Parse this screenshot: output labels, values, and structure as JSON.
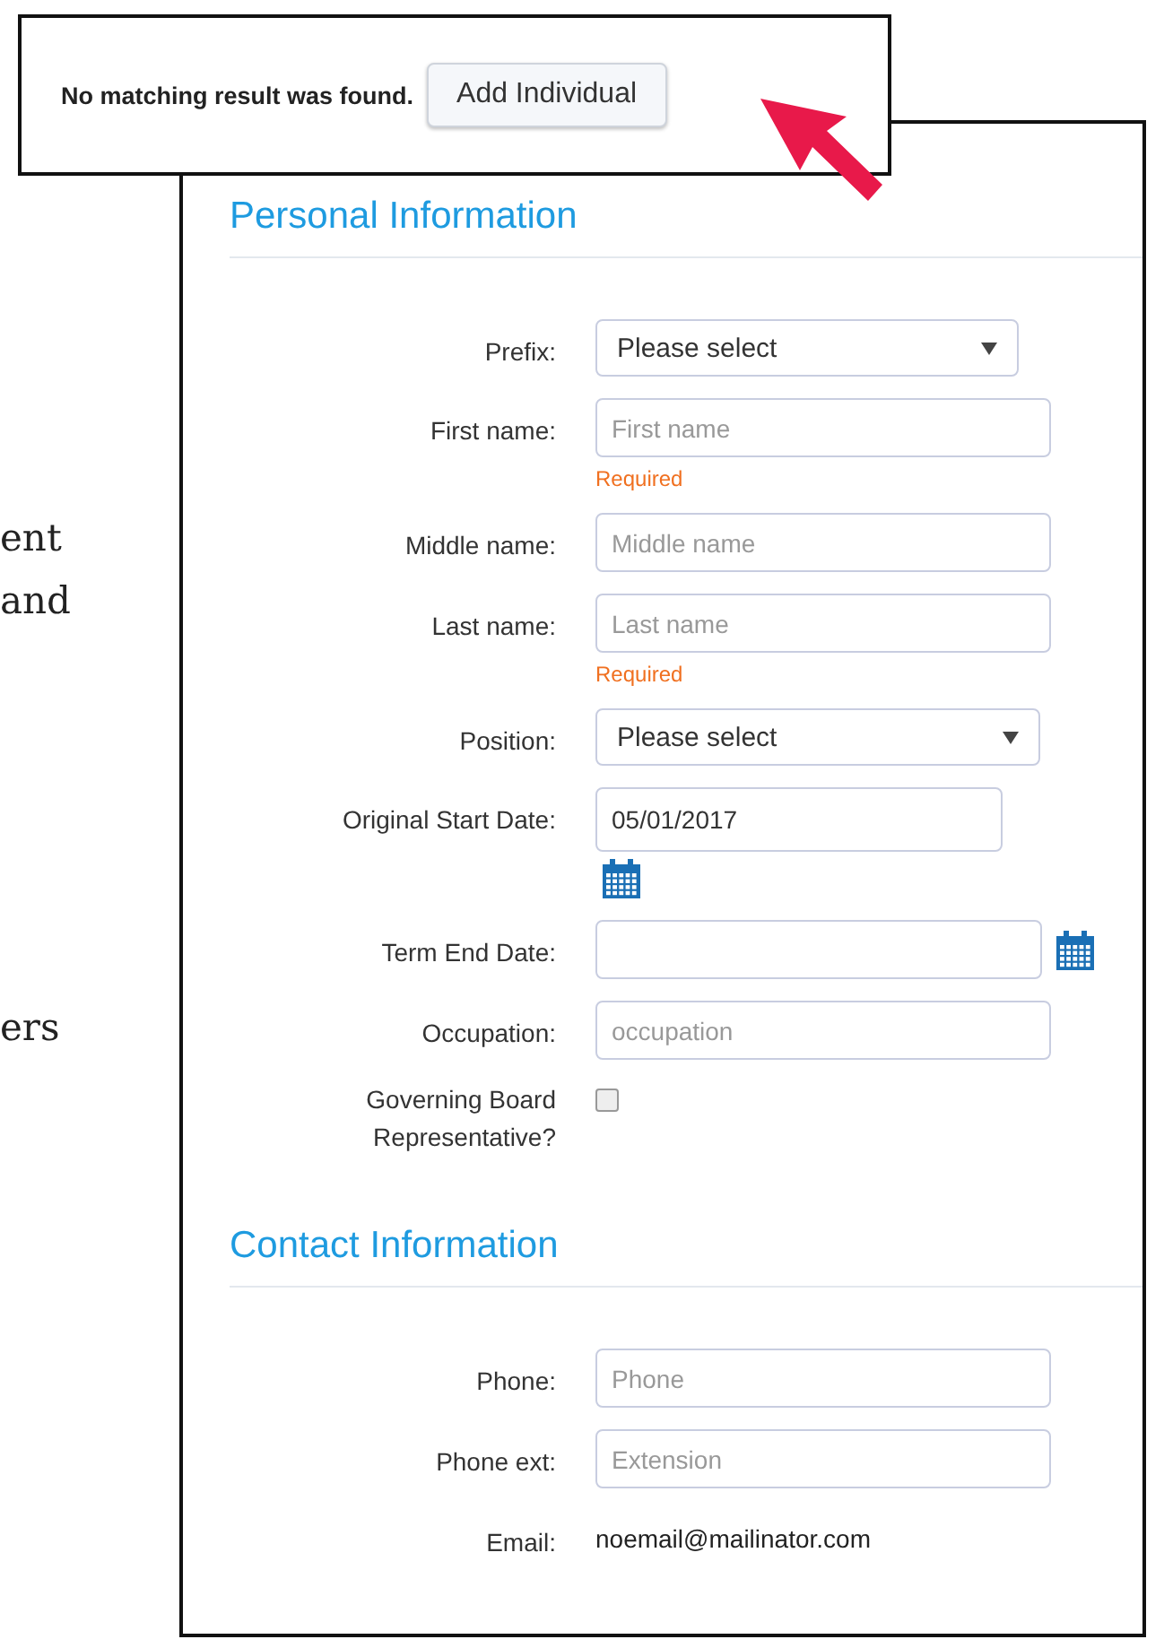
{
  "callout": {
    "message": "No matching result was found.",
    "button": "Add Individual"
  },
  "background_text": [
    "ent",
    "and",
    "ers"
  ],
  "sections": [
    {
      "title": "Personal Information",
      "fields": [
        {
          "kind": "select",
          "label": "Prefix:",
          "value": "Please select"
        },
        {
          "kind": "text",
          "label": "First name:",
          "placeholder": "First name",
          "hint": "Required"
        },
        {
          "kind": "text",
          "label": "Middle name:",
          "placeholder": "Middle name"
        },
        {
          "kind": "text",
          "label": "Last name:",
          "placeholder": "Last name",
          "hint": "Required"
        },
        {
          "kind": "select",
          "label": "Position:",
          "value": "Please select"
        },
        {
          "kind": "date",
          "label": "Original Start Date:",
          "value": "05/01/2017",
          "icon_below": true
        },
        {
          "kind": "date",
          "label": "Term End Date:",
          "icon_below": false
        },
        {
          "kind": "text",
          "label": "Occupation:",
          "placeholder": "occupation"
        },
        {
          "kind": "checkbox",
          "label": "Governing Board Representative?",
          "checked": false
        }
      ]
    },
    {
      "title": "Contact Information",
      "fields": [
        {
          "kind": "text",
          "label": "Phone:",
          "placeholder": "Phone"
        },
        {
          "kind": "text",
          "label": "Phone ext:",
          "placeholder": "Extension"
        },
        {
          "kind": "static",
          "label": "Email:",
          "value": "noemail@mailinator.com"
        }
      ]
    }
  ]
}
